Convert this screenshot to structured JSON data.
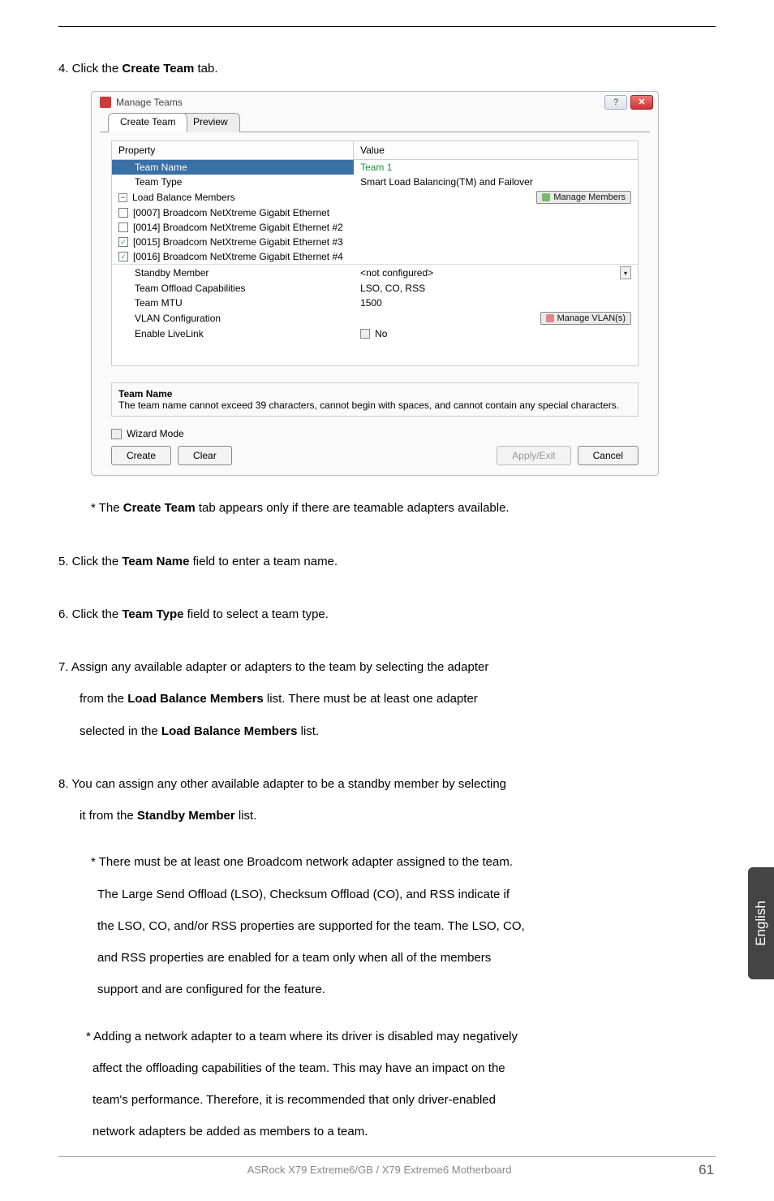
{
  "step4": {
    "prefix": "4. Click the ",
    "bold": "Create Team",
    "suffix": " tab."
  },
  "dialog": {
    "title": "Manage Teams",
    "help_glyph": "?",
    "close_glyph": "✕",
    "tabs": {
      "create": "Create Team",
      "preview": "Preview"
    },
    "headers": {
      "property": "Property",
      "value": "Value"
    },
    "rows": {
      "team_name": {
        "label": "Team Name",
        "value": "Team 1"
      },
      "team_type": {
        "label": "Team Type",
        "value": "Smart Load Balancing(TM) and Failover"
      },
      "load_balance": {
        "label": "Load Balance Members",
        "btn": "Manage Members",
        "toggle": "−"
      },
      "adapters": [
        {
          "checked": false,
          "label": "[0007] Broadcom NetXtreme Gigabit Ethernet"
        },
        {
          "checked": false,
          "label": "[0014] Broadcom NetXtreme Gigabit Ethernet #2"
        },
        {
          "checked": true,
          "label": "[0015] Broadcom NetXtreme Gigabit Ethernet #3"
        },
        {
          "checked": true,
          "label": "[0016] Broadcom NetXtreme Gigabit Ethernet #4"
        }
      ],
      "standby": {
        "label": "Standby Member",
        "value": "<not configured>"
      },
      "offload": {
        "label": "Team Offload Capabilities",
        "value": "LSO, CO, RSS"
      },
      "mtu": {
        "label": "Team MTU",
        "value": "1500"
      },
      "vlan": {
        "label": "VLAN Configuration",
        "btn": "Manage VLAN(s)"
      },
      "livelink": {
        "label": "Enable LiveLink",
        "value": "No"
      }
    },
    "desc": {
      "header": "Team Name",
      "text": "The team name cannot exceed 39 characters, cannot begin with spaces, and cannot contain any special characters."
    },
    "wizard": "Wizard Mode",
    "buttons": {
      "create": "Create",
      "clear": "Clear",
      "apply": "Apply/Exit",
      "cancel": "Cancel"
    }
  },
  "note_after_dialog": {
    "prefix": "* The ",
    "bold": "Create Team",
    "suffix": " tab appears only if there are teamable adapters available."
  },
  "step5": {
    "p1": "5. Click the ",
    "b1": "Team Name",
    "p2": " field to enter a team name."
  },
  "step6": {
    "p1": "6. Click the ",
    "b1": "Team Type",
    "p2": " field to select a team type."
  },
  "step7": {
    "line1a": "7. Assign any available adapter or adapters to the team by selecting the adapter",
    "line2a": "from the ",
    "b1": "Load Balance Members",
    "line2b": " list. There must be at least one adapter",
    "line3a": "selected in the ",
    "b2": "Load Balance Members",
    "line3b": " list."
  },
  "step8": {
    "line1": "8. You can assign any other available adapter to be a standby member by selecting",
    "line2a": "it from the ",
    "b1": "Standby Member",
    "line2b": " list."
  },
  "note1": {
    "l1": "* There must be at least one Broadcom network adapter assigned to the team.",
    "l2": "The Large Send Offload (LSO), Checksum Offload (CO), and RSS indicate if",
    "l3": "the LSO, CO, and/or RSS properties are supported for the team. The LSO, CO,",
    "l4": "and RSS properties are enabled for a team only when all of the members",
    "l5": "support and are configured for the feature."
  },
  "note2": {
    "l1": "* Adding a network adapter to a team where its driver is disabled may negatively",
    "l2": "affect the offloading capabilities of the team. This may have an impact on the",
    "l3": "team's performance. Therefore, it is recommended that only driver-enabled",
    "l4": "network adapters be added as members to a team."
  },
  "side_tab": "English",
  "footer": {
    "product": "ASRock  X79 Extreme6/GB / X79 Extreme6  Motherboard",
    "page": "61"
  }
}
